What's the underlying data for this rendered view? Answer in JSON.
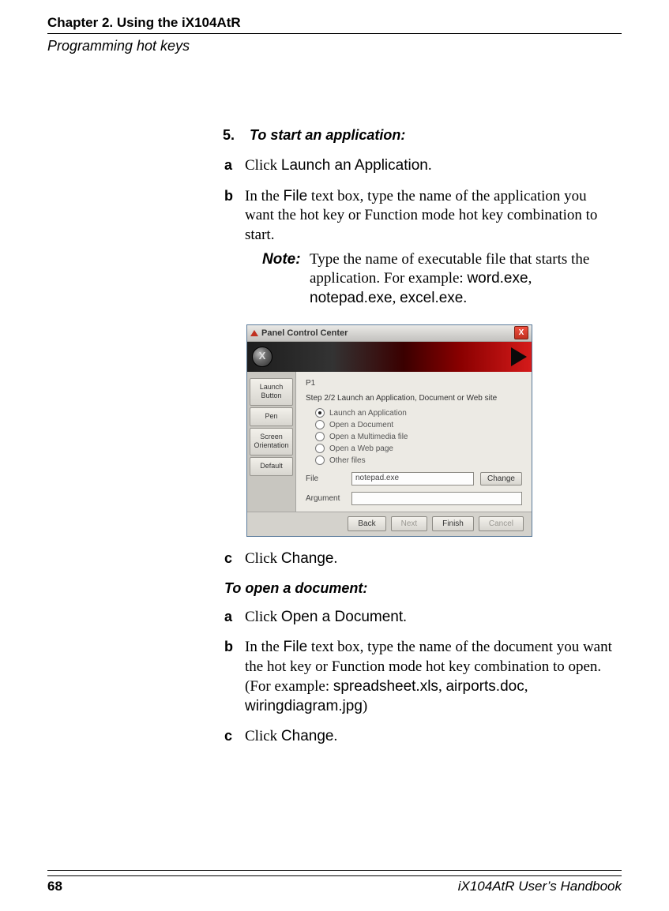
{
  "header": {
    "chapter": "Chapter 2. Using the iX104AtR",
    "section": "Programming hot keys"
  },
  "step5": {
    "number": "5.",
    "title": "To start an application:",
    "a_letter": "a",
    "a_pre": "Click ",
    "a_sans": "Launch an Application",
    "a_post": ".",
    "b_letter": "b",
    "b_pre": "In the ",
    "b_sans": "File",
    "b_post": " text box, type the name of the application you want the hot key or Function mode hot key combination to start.",
    "note_label": "Note:",
    "note_pre": "Type the name of executable file that starts the application. For example: ",
    "note_ex1": "word.exe",
    "note_sep1": ", ",
    "note_ex2": "notepad.exe",
    "note_sep2": ", ",
    "note_ex3": "excel.exe",
    "note_post": ".",
    "c_letter": "c",
    "c_pre": "Click ",
    "c_sans": "Change",
    "c_post": "."
  },
  "doc_section": {
    "title": "To open a document:",
    "a_letter": "a",
    "a_pre": "Click ",
    "a_sans": "Open a Document",
    "a_post": ".",
    "b_letter": "b",
    "b_pre": "In the ",
    "b_sans": "File",
    "b_mid": " text box, type the name of the document you want the hot key or Function mode hot key combination to open. (For example: ",
    "b_ex1": "spreadsheet.xls",
    "b_sep1": ", ",
    "b_ex2": "airports.doc",
    "b_sep2": ", ",
    "b_ex3": "wiringdiagram.jpg",
    "b_post": ")",
    "c_letter": "c",
    "c_pre": "Click ",
    "c_sans": "Change",
    "c_post": "."
  },
  "screenshot": {
    "window_title": "Panel Control Center",
    "close_x": "X",
    "logo_text": "X",
    "tabs": {
      "launch": "Launch\nButton",
      "pen": "Pen",
      "screen": "Screen\nOrientation",
      "default": "Default"
    },
    "panel": {
      "p1": "P1",
      "step_line": "Step 2/2    Launch an Application, Document or Web site",
      "opts": {
        "launch": "Launch an Application",
        "open_doc": "Open a Document",
        "open_mm": "Open a Multimedia file",
        "open_web": "Open a Web page",
        "other": "Other files"
      },
      "file_label": "File",
      "file_value": "notepad.exe",
      "change_btn": "Change",
      "arg_label": "Argument",
      "arg_value": ""
    },
    "buttons": {
      "back": "Back",
      "next": "Next",
      "finish": "Finish",
      "cancel": "Cancel"
    }
  },
  "footer": {
    "page_num": "68",
    "handbook": "iX104AtR User’s Handbook"
  }
}
